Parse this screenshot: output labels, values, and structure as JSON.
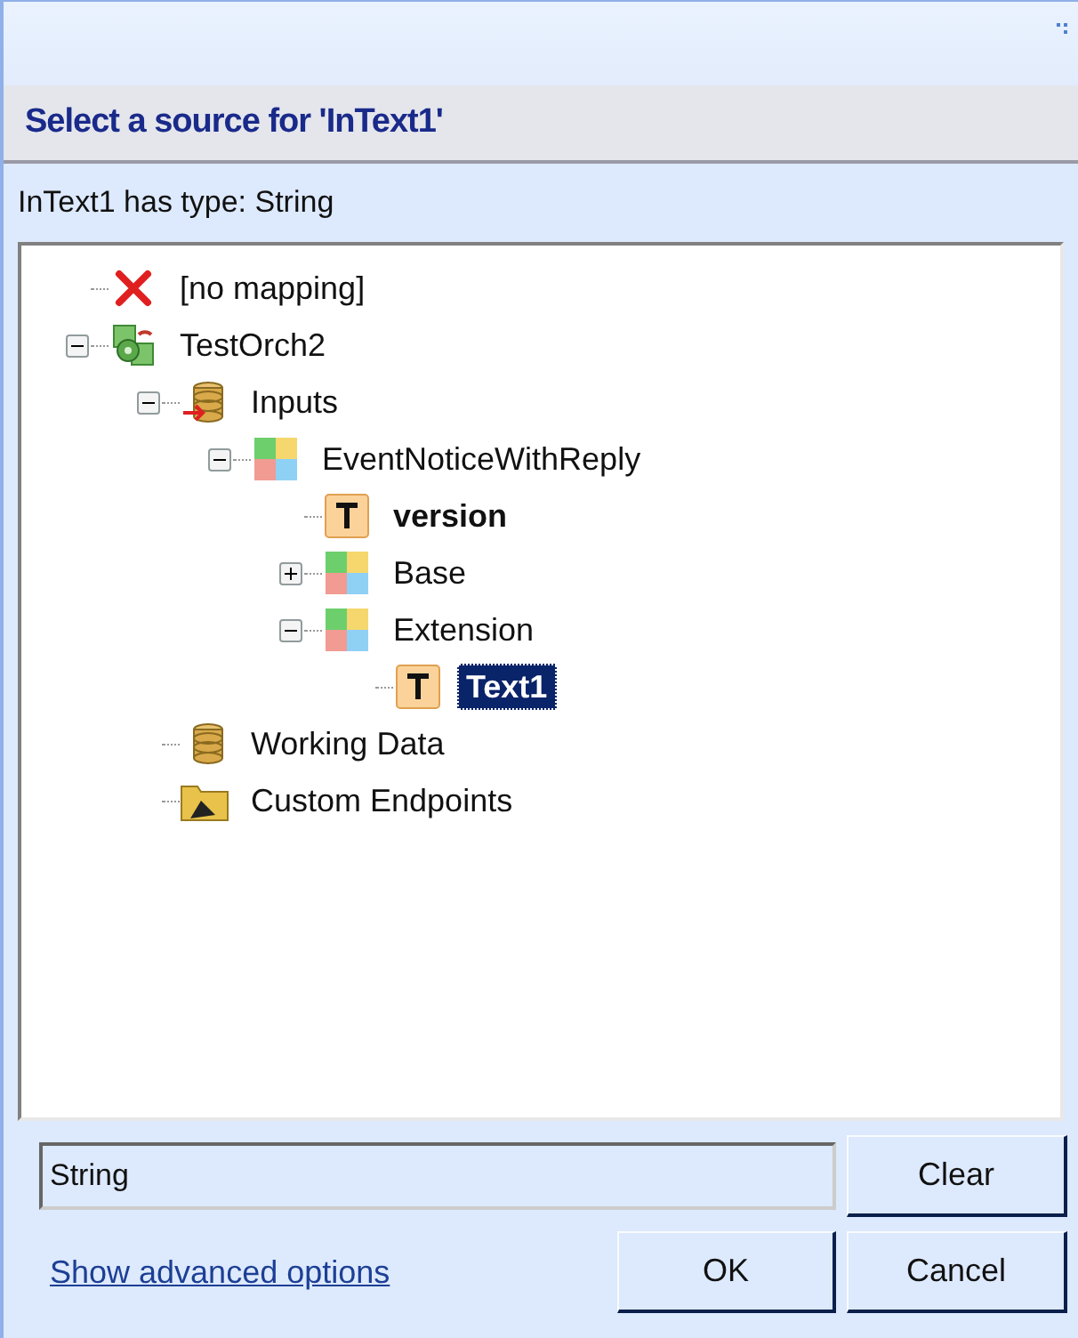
{
  "header": {
    "title": "Select a source for 'InText1'"
  },
  "subtitle": "InText1 has type: String",
  "tree": [
    {
      "label": "[no mapping]",
      "kind": "none",
      "bold": false,
      "selected": false
    },
    {
      "label": "TestOrch2",
      "kind": "orchestration",
      "bold": false,
      "selected": false,
      "expanded": true,
      "children": [
        {
          "label": "Inputs",
          "kind": "inputs",
          "bold": false,
          "selected": false,
          "expanded": true,
          "children": [
            {
              "label": "EventNoticeWithReply",
              "kind": "composite",
              "bold": false,
              "selected": false,
              "expanded": true,
              "children": [
                {
                  "label": "version",
                  "kind": "text",
                  "bold": true,
                  "selected": false
                },
                {
                  "label": "Base",
                  "kind": "composite",
                  "bold": false,
                  "selected": false,
                  "expanded": false
                },
                {
                  "label": "Extension",
                  "kind": "composite",
                  "bold": false,
                  "selected": false,
                  "expanded": true,
                  "children": [
                    {
                      "label": "Text1",
                      "kind": "text",
                      "bold": true,
                      "selected": true
                    }
                  ]
                }
              ]
            }
          ]
        },
        {
          "label": "Working Data",
          "kind": "data",
          "bold": false,
          "selected": false
        },
        {
          "label": "Custom Endpoints",
          "kind": "folder",
          "bold": false,
          "selected": false
        }
      ]
    }
  ],
  "type_field": {
    "value": "String"
  },
  "clear_button": "Clear",
  "advanced_link": "Show advanced options",
  "ok_button": "OK",
  "cancel_button": "Cancel"
}
